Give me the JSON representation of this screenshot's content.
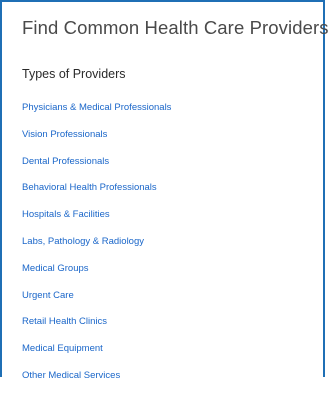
{
  "page": {
    "title": "Find Common Health Care Providers"
  },
  "section": {
    "heading": "Types of Providers"
  },
  "providers": [
    {
      "label": "Physicians & Medical Professionals"
    },
    {
      "label": "Vision Professionals"
    },
    {
      "label": "Dental Professionals"
    },
    {
      "label": "Behavioral Health Professionals"
    },
    {
      "label": "Hospitals & Facilities"
    },
    {
      "label": "Labs, Pathology & Radiology"
    },
    {
      "label": "Medical Groups"
    },
    {
      "label": "Urgent Care"
    },
    {
      "label": "Retail Health Clinics"
    },
    {
      "label": "Medical Equipment"
    },
    {
      "label": "Other Medical Services"
    }
  ],
  "colors": {
    "frame_border": "#1f6fb5",
    "link": "#1a66c9",
    "title": "#4a4a4a",
    "heading": "#2a2a2a"
  }
}
